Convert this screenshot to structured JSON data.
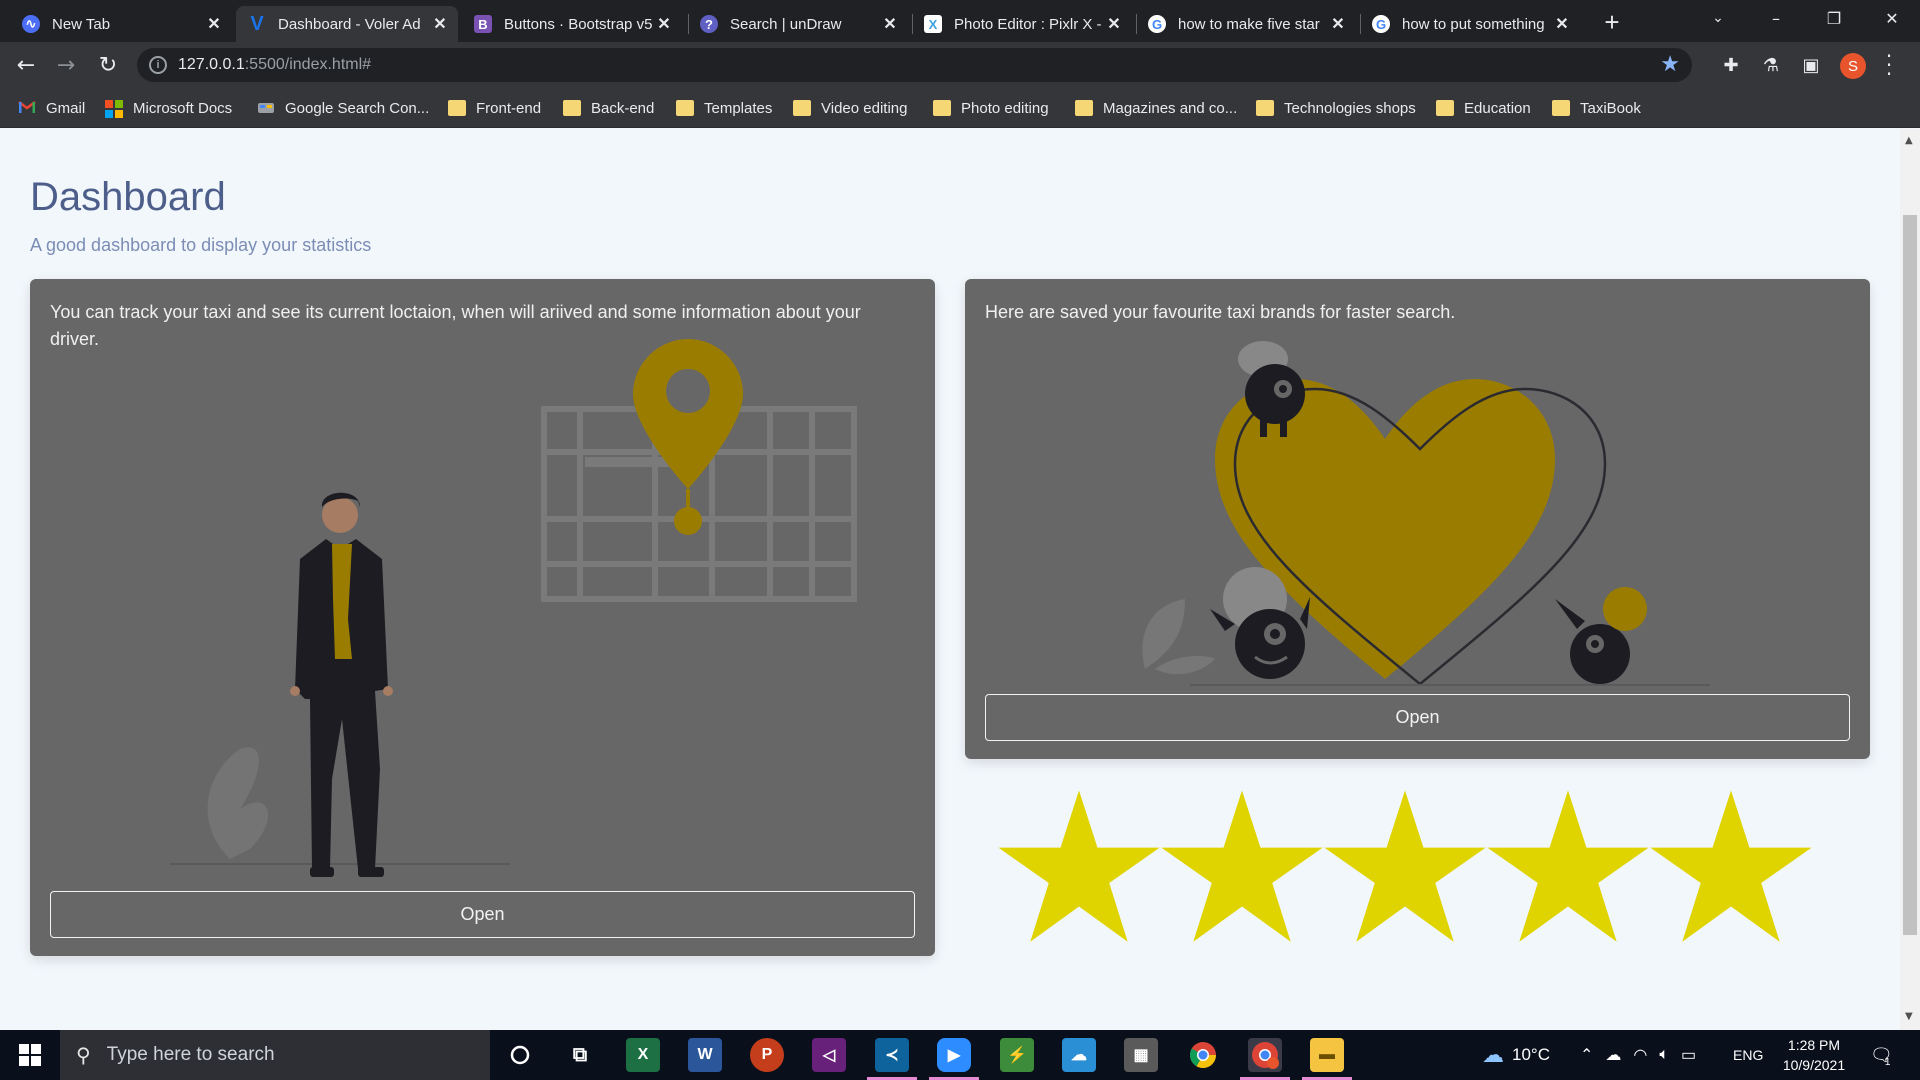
{
  "browser": {
    "tabs": [
      {
        "title": "New Tab",
        "favicon": "new-tab-favicon",
        "color": "#4c6ef5"
      },
      {
        "title": "Dashboard - Voler Ad",
        "favicon": "voler-favicon",
        "color": "#1a73e8",
        "active": true
      },
      {
        "title": "Buttons · Bootstrap v5",
        "favicon": "bootstrap-favicon",
        "color": "#7952b3"
      },
      {
        "title": "Search | unDraw",
        "favicon": "undraw-favicon",
        "color": "#5f5fc4"
      },
      {
        "title": "Photo Editor : Pixlr X -",
        "favicon": "pixlr-favicon",
        "color": "#3aa0e0"
      },
      {
        "title": "how to make five star",
        "favicon": "google-favicon",
        "color": "#ffffff"
      },
      {
        "title": "how to put something",
        "favicon": "google-favicon",
        "color": "#ffffff"
      }
    ],
    "new_tab_label": "+",
    "url_host": "127.0.0.1",
    "url_rest": ":5500/index.html#",
    "bookmarks": [
      {
        "label": "Gmail",
        "icon": "gmail-icon"
      },
      {
        "label": "Microsoft Docs",
        "icon": "microsoft-icon"
      },
      {
        "label": "Google Search Con...",
        "icon": "search-console-icon"
      },
      {
        "label": "Front-end",
        "icon": "folder-icon"
      },
      {
        "label": "Back-end",
        "icon": "folder-icon"
      },
      {
        "label": "Templates",
        "icon": "folder-icon"
      },
      {
        "label": "Video editing",
        "icon": "folder-icon"
      },
      {
        "label": "Photo editing",
        "icon": "folder-icon"
      },
      {
        "label": "Magazines and co...",
        "icon": "folder-icon"
      },
      {
        "label": "Technologies shops",
        "icon": "folder-icon"
      },
      {
        "label": "Education",
        "icon": "folder-icon"
      },
      {
        "label": "TaxiBook",
        "icon": "folder-icon"
      }
    ],
    "profile_initial": "S"
  },
  "page": {
    "title": "Dashboard",
    "subtitle": "A good dashboard to display your statistics",
    "cards": [
      {
        "text": "You can track your taxi and see its current loctaion, when will ariived and some information about your driver.",
        "button": "Open"
      },
      {
        "text": "Here are saved your favourite taxi brands for faster search.",
        "button": "Open"
      }
    ],
    "rating": {
      "value": 5,
      "max": 5,
      "color": "#dfd400"
    }
  },
  "colors": {
    "card_bg": "#676767",
    "accent_gold": "#b38f00",
    "title": "#25396f"
  },
  "taskbar": {
    "search_placeholder": "Type here to search",
    "apps": [
      "cortana-icon",
      "task-view-icon",
      "excel-icon",
      "word-icon",
      "powerpoint-icon",
      "visual-studio-icon",
      "vscode-icon",
      "zoom-icon",
      "app-icon",
      "azure-icon",
      "calculator-icon",
      "chrome-icon",
      "chrome-profile-icon",
      "file-explorer-icon"
    ],
    "weather": "10°C",
    "language": "ENG",
    "time": "1:28 PM",
    "date": "10/9/2021",
    "notification_count": "1"
  }
}
